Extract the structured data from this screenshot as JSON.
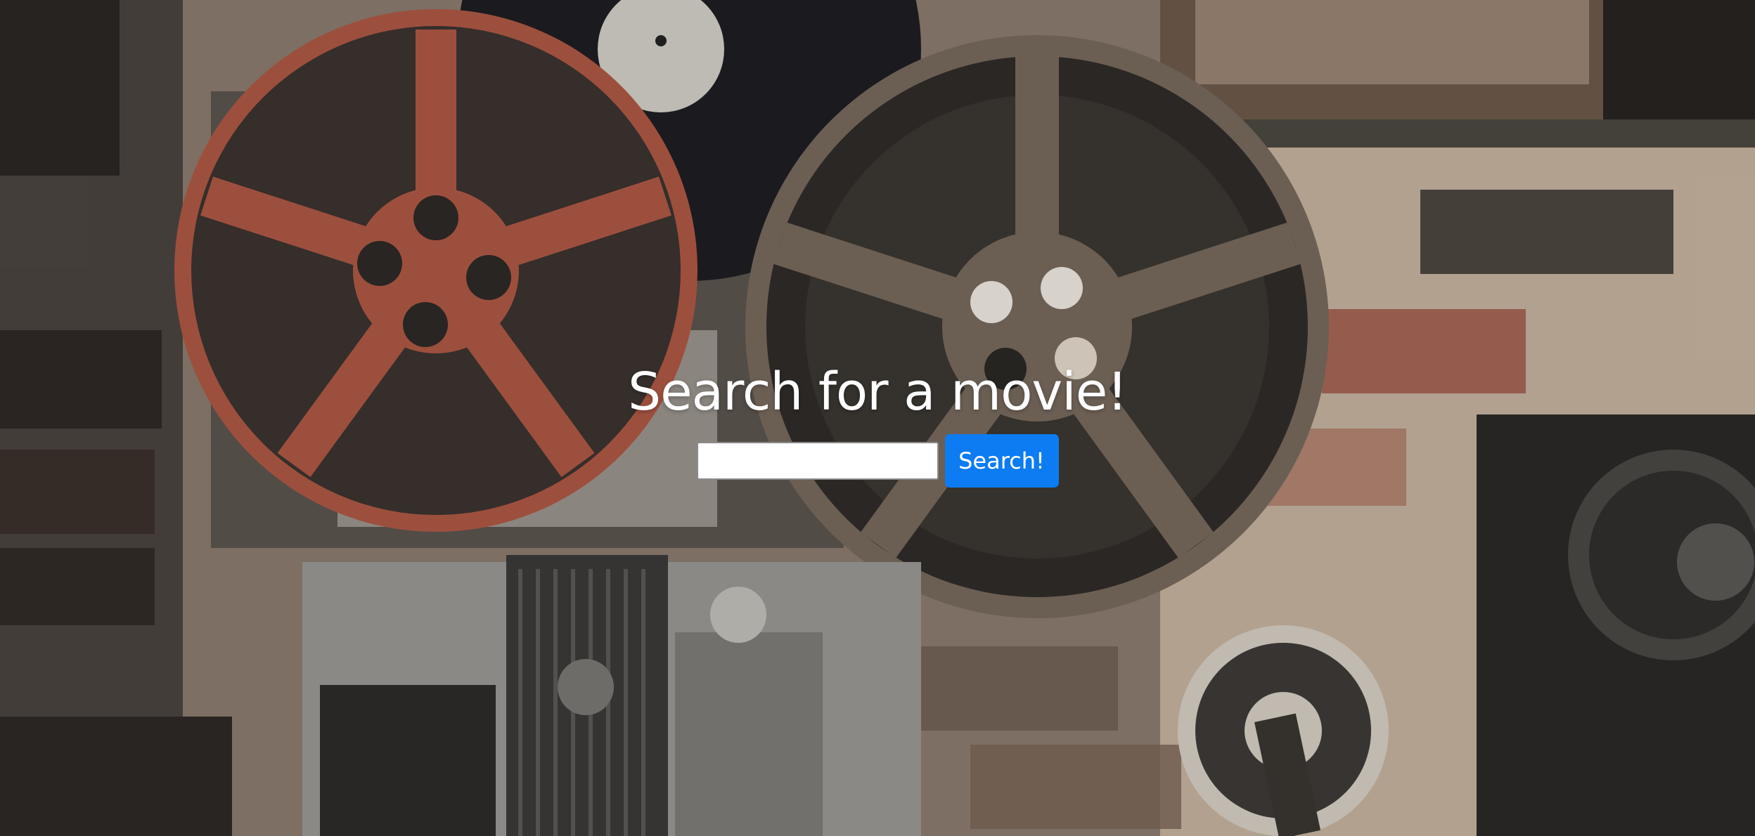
{
  "hero": {
    "title": "Search for a movie!"
  },
  "search": {
    "value": "",
    "placeholder": "",
    "button_label": "Search!"
  },
  "colors": {
    "button_bg": "#0d7cf2",
    "button_text": "#ffffff",
    "title_text": "#ffffff"
  },
  "background": {
    "subject": "vintage film reels and projectors photo"
  }
}
